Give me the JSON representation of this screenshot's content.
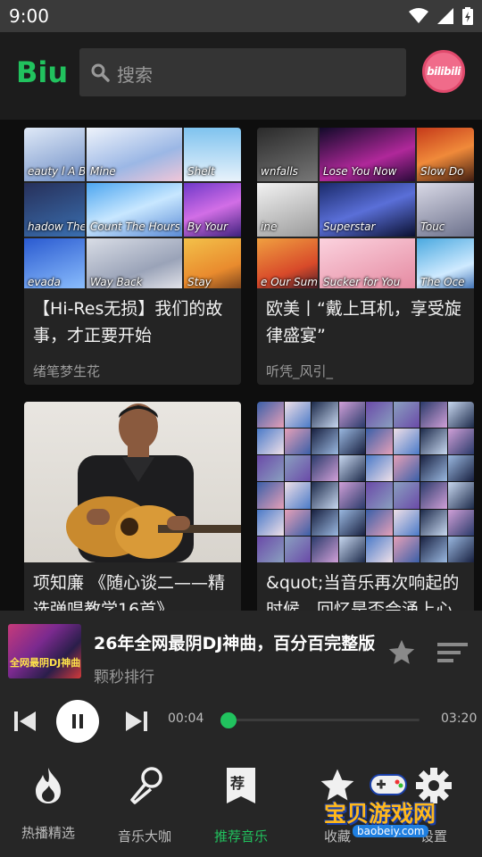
{
  "status_bar": {
    "time": "9:00"
  },
  "header": {
    "logo": "Biu",
    "search_placeholder": "搜索",
    "bili_label": "bilibili"
  },
  "cards": [
    {
      "title": "【Hi-Res无损】我们的故事，才正要开始",
      "author": "绪笔梦生花",
      "tiles": [
        "eauty l A Beat",
        "Mine",
        "Shelt",
        "hadow The Sun",
        "Count The Hours",
        "By Your",
        "evada",
        "Way Back",
        "Stay"
      ]
    },
    {
      "title": "欧美丨“戴上耳机，享受旋律盛宴”",
      "author": "听凭_风引_",
      "tiles": [
        "wnfalls",
        "Lose You Now",
        "Slow Do",
        "ine",
        "Superstar",
        "Touc",
        "e Our Summer",
        "Sucker for You",
        "The Oce"
      ]
    },
    {
      "title": "项知廉 《随心谈二——精选弹唱教学16首》",
      "author": ""
    },
    {
      "title": "&quot;当音乐再次响起的时候，回忆是否会涌上心头",
      "author": ""
    }
  ],
  "player": {
    "cover_text": "全网最阴DJ神曲",
    "title": "26年全网最阴DJ神曲，百分百完整版",
    "artist": "颗秒排行",
    "current_time": "00:04",
    "total_time": "03:20",
    "progress": 0.02
  },
  "nav": [
    {
      "label": "热播精选",
      "icon": "fire-icon"
    },
    {
      "label": "音乐大咖",
      "icon": "microphone-icon"
    },
    {
      "label": "推荐音乐",
      "icon": "recommend-icon",
      "badge": "荐",
      "active": true
    },
    {
      "label": "收藏",
      "icon": "star-icon"
    },
    {
      "label": "设置",
      "icon": "gear-icon"
    }
  ],
  "watermark": {
    "text": "宝贝游戏网",
    "url": "baobeiy.com"
  },
  "colors": {
    "accent": "#21c25e",
    "background": "#0e0e0e",
    "card": "#242424",
    "player": "#262626"
  }
}
